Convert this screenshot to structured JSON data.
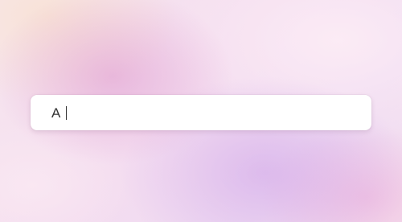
{
  "search": {
    "value": "A"
  }
}
